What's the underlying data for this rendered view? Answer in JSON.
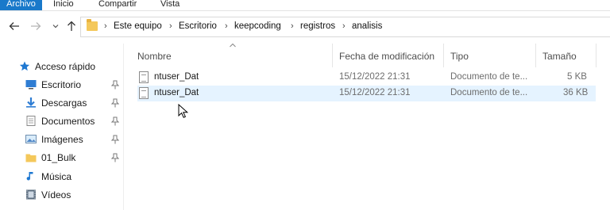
{
  "ribbon": {
    "tabs": [
      "Archivo",
      "Inicio",
      "Compartir",
      "Vista"
    ]
  },
  "nav": {
    "back_icon": "arrow-left-icon",
    "forward_icon": "arrow-right-icon",
    "recent_icon": "chevron-down-icon",
    "up_icon": "arrow-up-icon"
  },
  "breadcrumb": [
    "Este equipo",
    "Escritorio",
    "keepcoding",
    "registros",
    "analisis"
  ],
  "sidebar": {
    "items": [
      {
        "label": "Acceso rápido",
        "icon": "star-icon",
        "pinned": false
      },
      {
        "label": "Escritorio",
        "icon": "desktop-icon",
        "pinned": true
      },
      {
        "label": "Descargas",
        "icon": "download-icon",
        "pinned": true
      },
      {
        "label": "Documentos",
        "icon": "documents-icon",
        "pinned": true
      },
      {
        "label": "Imágenes",
        "icon": "pictures-icon",
        "pinned": true
      },
      {
        "label": "01_Bulk",
        "icon": "folder-icon",
        "pinned": true
      },
      {
        "label": "Música",
        "icon": "music-icon",
        "pinned": false
      },
      {
        "label": "Vídeos",
        "icon": "video-icon",
        "pinned": false
      }
    ]
  },
  "columns": {
    "name": "Nombre",
    "modified": "Fecha de modificación",
    "type": "Tipo",
    "size": "Tamaño"
  },
  "files": [
    {
      "name": "ntuser_Dat",
      "modified": "15/12/2022 21:31",
      "type": "Documento de te...",
      "size": "5 KB",
      "state": "normal"
    },
    {
      "name": "ntuser_Dat",
      "modified": "15/12/2022 21:31",
      "type": "Documento de te...",
      "size": "36 KB",
      "state": "hover"
    }
  ],
  "colors": {
    "file_tab": "#1979ca",
    "row_hover": "#e5f3ff",
    "quick_access_star": "#1f78d1"
  }
}
